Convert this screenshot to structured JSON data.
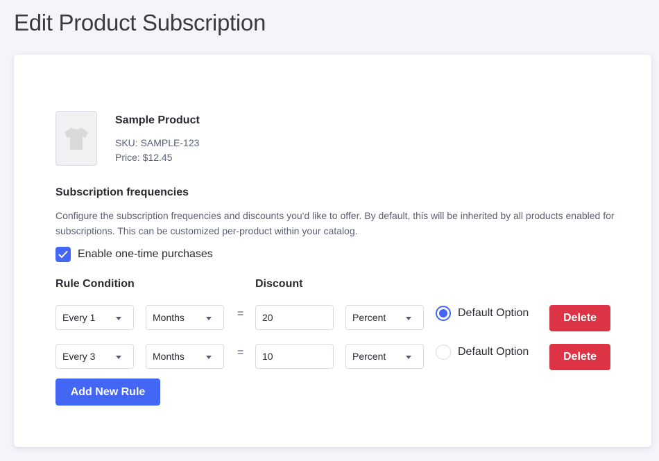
{
  "page": {
    "title": "Edit Product Subscription"
  },
  "product": {
    "name": "Sample Product",
    "sku": "SKU: SAMPLE-123",
    "price": "Price: $12.45",
    "image_icon": "tshirt-icon"
  },
  "frequencies": {
    "title": "Subscription frequencies",
    "description": "Configure the subscription frequencies and discounts you'd like to offer. By default, this will be inherited by all products enabled for subscriptions. This can be customized per-product within your catalog.",
    "one_time": {
      "label": "Enable one-time purchases",
      "checked": true
    }
  },
  "columns": {
    "rule_condition": "Rule Condition",
    "discount": "Discount"
  },
  "rules": [
    {
      "interval": "Every 1",
      "unit": "Months",
      "equals": "=",
      "discount_value": "20",
      "discount_type": "Percent",
      "default_label": "Default Option",
      "is_default": true,
      "delete_label": "Delete"
    },
    {
      "interval": "Every 3",
      "unit": "Months",
      "equals": "=",
      "discount_value": "10",
      "discount_type": "Percent",
      "default_label": "Default Option",
      "is_default": false,
      "delete_label": "Delete"
    }
  ],
  "actions": {
    "add_rule_label": "Add New Rule"
  },
  "colors": {
    "primary": "#4366f4",
    "danger": "#dc3444",
    "background": "#f4f5fa"
  }
}
